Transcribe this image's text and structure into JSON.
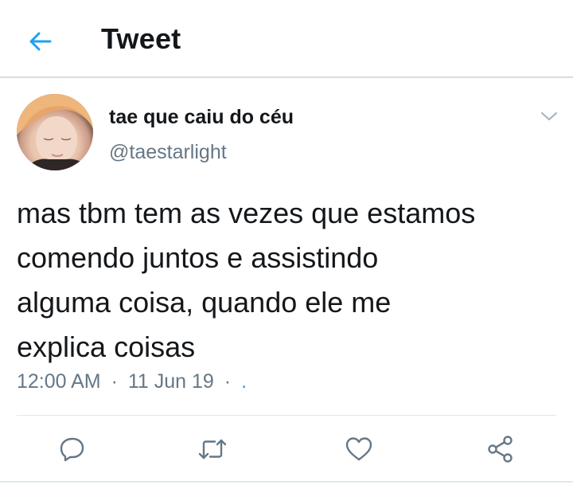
{
  "header": {
    "title": "Tweet",
    "back_icon": "arrow-left-icon",
    "accent_color": "#1da1f2"
  },
  "tweet": {
    "display_name": "tae que caiu do céu",
    "handle": "@taestarlight",
    "text": "mas tbm tem as vezes que estamos\ncomendo juntos e assistindo\nalguma coisa, quando ele me\nexplica coisas",
    "time": "12:00 AM",
    "date": "11 Jun 19",
    "separator": "·",
    "source": ".",
    "menu_icon": "chevron-down-icon"
  },
  "actions": [
    {
      "name": "reply",
      "icon": "reply-icon"
    },
    {
      "name": "retweet",
      "icon": "retweet-icon"
    },
    {
      "name": "like",
      "icon": "heart-icon"
    },
    {
      "name": "share",
      "icon": "share-icon"
    }
  ],
  "colors": {
    "text_primary": "#14171a",
    "text_secondary": "#657786",
    "icon_gray": "#657786",
    "divider": "#e1e8ed"
  }
}
